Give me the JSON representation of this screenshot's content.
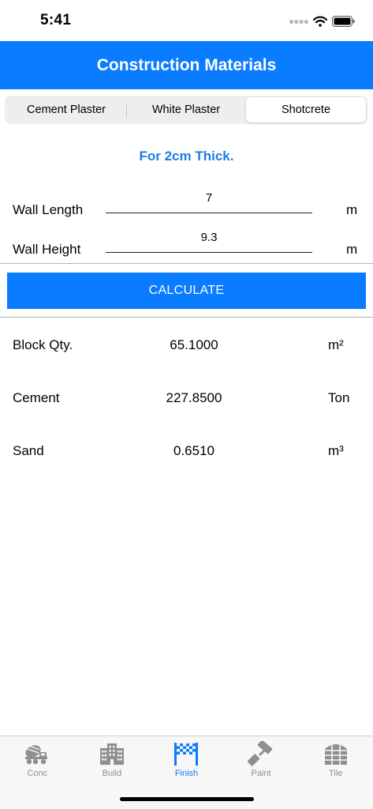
{
  "status_bar": {
    "time": "5:41"
  },
  "header": {
    "title": "Construction Materials"
  },
  "segments": [
    {
      "label": "Cement Plaster",
      "selected": false
    },
    {
      "label": "White Plaster",
      "selected": false
    },
    {
      "label": "Shotcrete",
      "selected": true
    }
  ],
  "thickness_label": "For 2cm Thick.",
  "inputs": {
    "wall_length": {
      "label": "Wall Length",
      "value": "7",
      "unit": "m"
    },
    "wall_height": {
      "label": "Wall Height",
      "value": "9.3",
      "unit": "m"
    }
  },
  "calculate_label": "CALCULATE",
  "results": [
    {
      "label": "Block Qty.",
      "value": "65.1000",
      "unit": "m²"
    },
    {
      "label": "Cement",
      "value": "227.8500",
      "unit": "Ton"
    },
    {
      "label": "Sand",
      "value": "0.6510",
      "unit": "m³"
    }
  ],
  "tabs": [
    {
      "label": "Conc",
      "icon": "concrete-mixer-icon",
      "active": false
    },
    {
      "label": "Build",
      "icon": "building-icon",
      "active": false
    },
    {
      "label": "Finish",
      "icon": "checkered-flag-icon",
      "active": true
    },
    {
      "label": "Paint",
      "icon": "paint-roller-icon",
      "active": false
    },
    {
      "label": "Tile",
      "icon": "tile-icon",
      "active": false
    }
  ],
  "colors": {
    "accent": "#0a7cff",
    "tab_inactive": "#8e8e93",
    "thickness_text": "#1a7de8"
  }
}
